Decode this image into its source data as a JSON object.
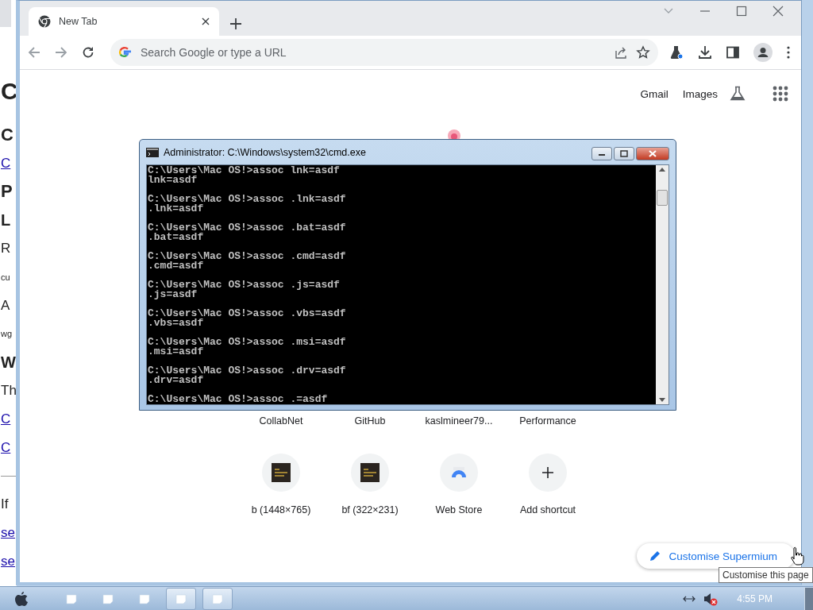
{
  "background_page": {
    "lines": [
      {
        "kind": "h1",
        "text": "C"
      },
      {
        "kind": "h2",
        "text": "C"
      },
      {
        "kind": "link",
        "text": "C"
      },
      {
        "kind": "h2",
        "text": "P"
      },
      {
        "kind": "h3",
        "text": "L"
      },
      {
        "kind": "p",
        "text": "R"
      },
      {
        "kind": "small",
        "text": "cu"
      },
      {
        "kind": "p",
        "text": "A"
      },
      {
        "kind": "small",
        "text": "wg"
      },
      {
        "kind": "h3",
        "text": "W"
      },
      {
        "kind": "p",
        "text": "Th"
      },
      {
        "kind": "link",
        "text": "C"
      },
      {
        "kind": "link",
        "text": "C"
      },
      {
        "kind": "rule"
      },
      {
        "kind": "p",
        "text": "If"
      },
      {
        "kind": "link",
        "text": "se"
      },
      {
        "kind": "link",
        "text": "se"
      }
    ]
  },
  "browser": {
    "tabs": [
      {
        "title": "New Tab",
        "selected": true
      }
    ],
    "omnibox": {
      "placeholder": "Search Google or type a URL"
    },
    "header_links": [
      "Gmail",
      "Images"
    ],
    "shortcuts": [
      {
        "label": "CollabNet",
        "kind": "covered"
      },
      {
        "label": "GitHub",
        "kind": "covered"
      },
      {
        "label": "kaslmineer79...",
        "kind": "covered"
      },
      {
        "label": "Performance",
        "kind": "covered"
      },
      {
        "label": "b (1448×765)",
        "kind": "thumbnail"
      },
      {
        "label": "bf (322×231)",
        "kind": "thumbnail"
      },
      {
        "label": "Web Store",
        "kind": "store"
      },
      {
        "label": "Add shortcut",
        "kind": "add"
      }
    ],
    "customise_button": "Customise Supermium"
  },
  "tooltip": "Customise this page",
  "cmd": {
    "title": "Administrator: C:\\Windows\\system32\\cmd.exe",
    "entries": [
      {
        "command": "C:\\Users\\Mac OS!>assoc lnk=asdf",
        "output": "lnk=asdf"
      },
      {
        "command": "C:\\Users\\Mac OS!>assoc .lnk=asdf",
        "output": ".lnk=asdf"
      },
      {
        "command": "C:\\Users\\Mac OS!>assoc .bat=asdf",
        "output": ".bat=asdf"
      },
      {
        "command": "C:\\Users\\Mac OS!>assoc .cmd=asdf",
        "output": ".cmd=asdf"
      },
      {
        "command": "C:\\Users\\Mac OS!>assoc .js=asdf",
        "output": ".js=asdf"
      },
      {
        "command": "C:\\Users\\Mac OS!>assoc .vbs=asdf",
        "output": ".vbs=asdf"
      },
      {
        "command": "C:\\Users\\Mac OS!>assoc .msi=asdf",
        "output": ".msi=asdf"
      },
      {
        "command": "C:\\Users\\Mac OS!>assoc .drv=asdf",
        "output": ".drv=asdf"
      },
      {
        "command": "C:\\Users\\Mac OS!>assoc .=asdf"
      }
    ]
  },
  "taskbar": {
    "buttons": [
      {
        "selected": false
      },
      {
        "selected": false
      },
      {
        "selected": false
      },
      {
        "selected": true
      },
      {
        "selected": true
      }
    ],
    "clock": "4:55 PM"
  }
}
